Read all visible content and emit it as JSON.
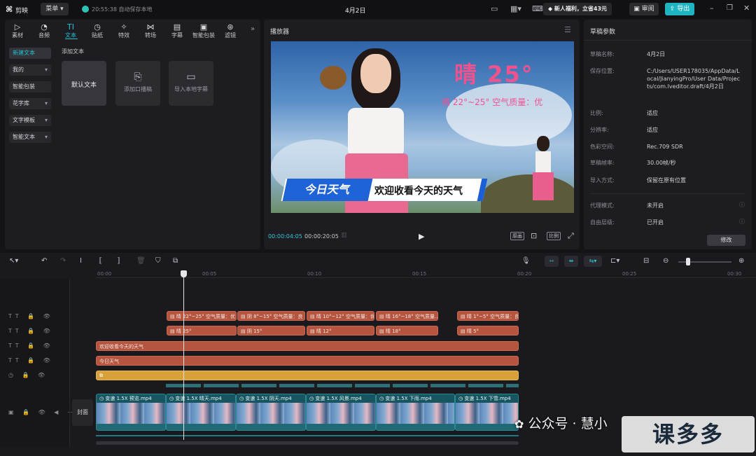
{
  "app": {
    "name": "剪映",
    "menu": "菜单",
    "autosave": "20:55:38 自动保存本地",
    "project_title": "4月2日",
    "promo": "新人福利，立省43元",
    "review": "审阅",
    "export": "导出"
  },
  "media_tabs": [
    {
      "label": "素材",
      "icon": "media-icon"
    },
    {
      "label": "音频",
      "icon": "audio-icon"
    },
    {
      "label": "文本",
      "icon": "text-icon"
    },
    {
      "label": "贴纸",
      "icon": "sticker-icon"
    },
    {
      "label": "特效",
      "icon": "effects-icon"
    },
    {
      "label": "转场",
      "icon": "transition-icon"
    },
    {
      "label": "字幕",
      "icon": "caption-icon"
    },
    {
      "label": "智能包装",
      "icon": "smart-pack-icon"
    },
    {
      "label": "滤镜",
      "icon": "filter-icon"
    }
  ],
  "text_sidebar": [
    {
      "label": "新建文本"
    },
    {
      "label": "我的"
    },
    {
      "label": "智能包装"
    },
    {
      "label": "花字库"
    },
    {
      "label": "文字模板"
    },
    {
      "label": "智能文本"
    }
  ],
  "text_panel": {
    "section": "添加文本",
    "cards": [
      {
        "label": "默认文本"
      },
      {
        "label": "添加口播稿"
      },
      {
        "label": "导入本地字幕"
      }
    ]
  },
  "player": {
    "title": "播放器",
    "current_time": "00:00:04:05",
    "total_time": "00:00:20:05",
    "btn_orig": "原画",
    "btn_ratio": "比例",
    "overlay": {
      "weather_big": "晴 25°",
      "weather_small": "晴 22°~25° 空气质量：优",
      "banner_left": "今日天气",
      "banner_right": "欢迎收看今天的天气"
    }
  },
  "draft": {
    "title": "草稿参数",
    "rows": [
      {
        "label": "草稿名称:",
        "value": "4月2日"
      },
      {
        "label": "保存位置:",
        "value": "C:/Users/USER178035/AppData/Local/JianyingPro/User Data/Projects/com.lveditor.draft/4月2日"
      },
      {
        "label": "比例:",
        "value": "适应"
      },
      {
        "label": "分辨率:",
        "value": "适应"
      },
      {
        "label": "色彩空间:",
        "value": "Rec.709 SDR"
      },
      {
        "label": "草稿帧率:",
        "value": "30.00帧/秒"
      },
      {
        "label": "导入方式:",
        "value": "保留在原有位置"
      },
      {
        "label": "代理模式:",
        "value": "未开启"
      },
      {
        "label": "自由层级:",
        "value": "已开启"
      }
    ],
    "edit_btn": "修改"
  },
  "timeline": {
    "ticks": [
      "00:00",
      "00:05",
      "00:10",
      "00:15",
      "00:20",
      "00:25",
      "00:30"
    ],
    "track1": [
      "晴 22°~25° 空气质量：优",
      "阴 8°~15° 空气质量：良",
      "晴 10°~12° 空气质量：优",
      "晴 16°~18° 空气质量...",
      "晴 1°~5° 空气质量：良"
    ],
    "track2": [
      "晴 25°",
      "阴 15°",
      "晴 12°",
      "晴 18°",
      "晴 5°"
    ],
    "track3": "欢迎收看今天的天气",
    "track4": "今日天气",
    "cover": "封面",
    "video_clips": [
      "变速 1.5X  预览.mp4",
      "变速 1.5X  晴天.mp4",
      "变速 1.5X  阴天.mp4",
      "变速 1.5X  风景.mp4",
      "变速 1.5X  下雨.mp4",
      "变速 1.5X  下雪.mp4"
    ]
  },
  "watermark": {
    "text": "公众号 · 慧小",
    "brand": "课多多"
  }
}
